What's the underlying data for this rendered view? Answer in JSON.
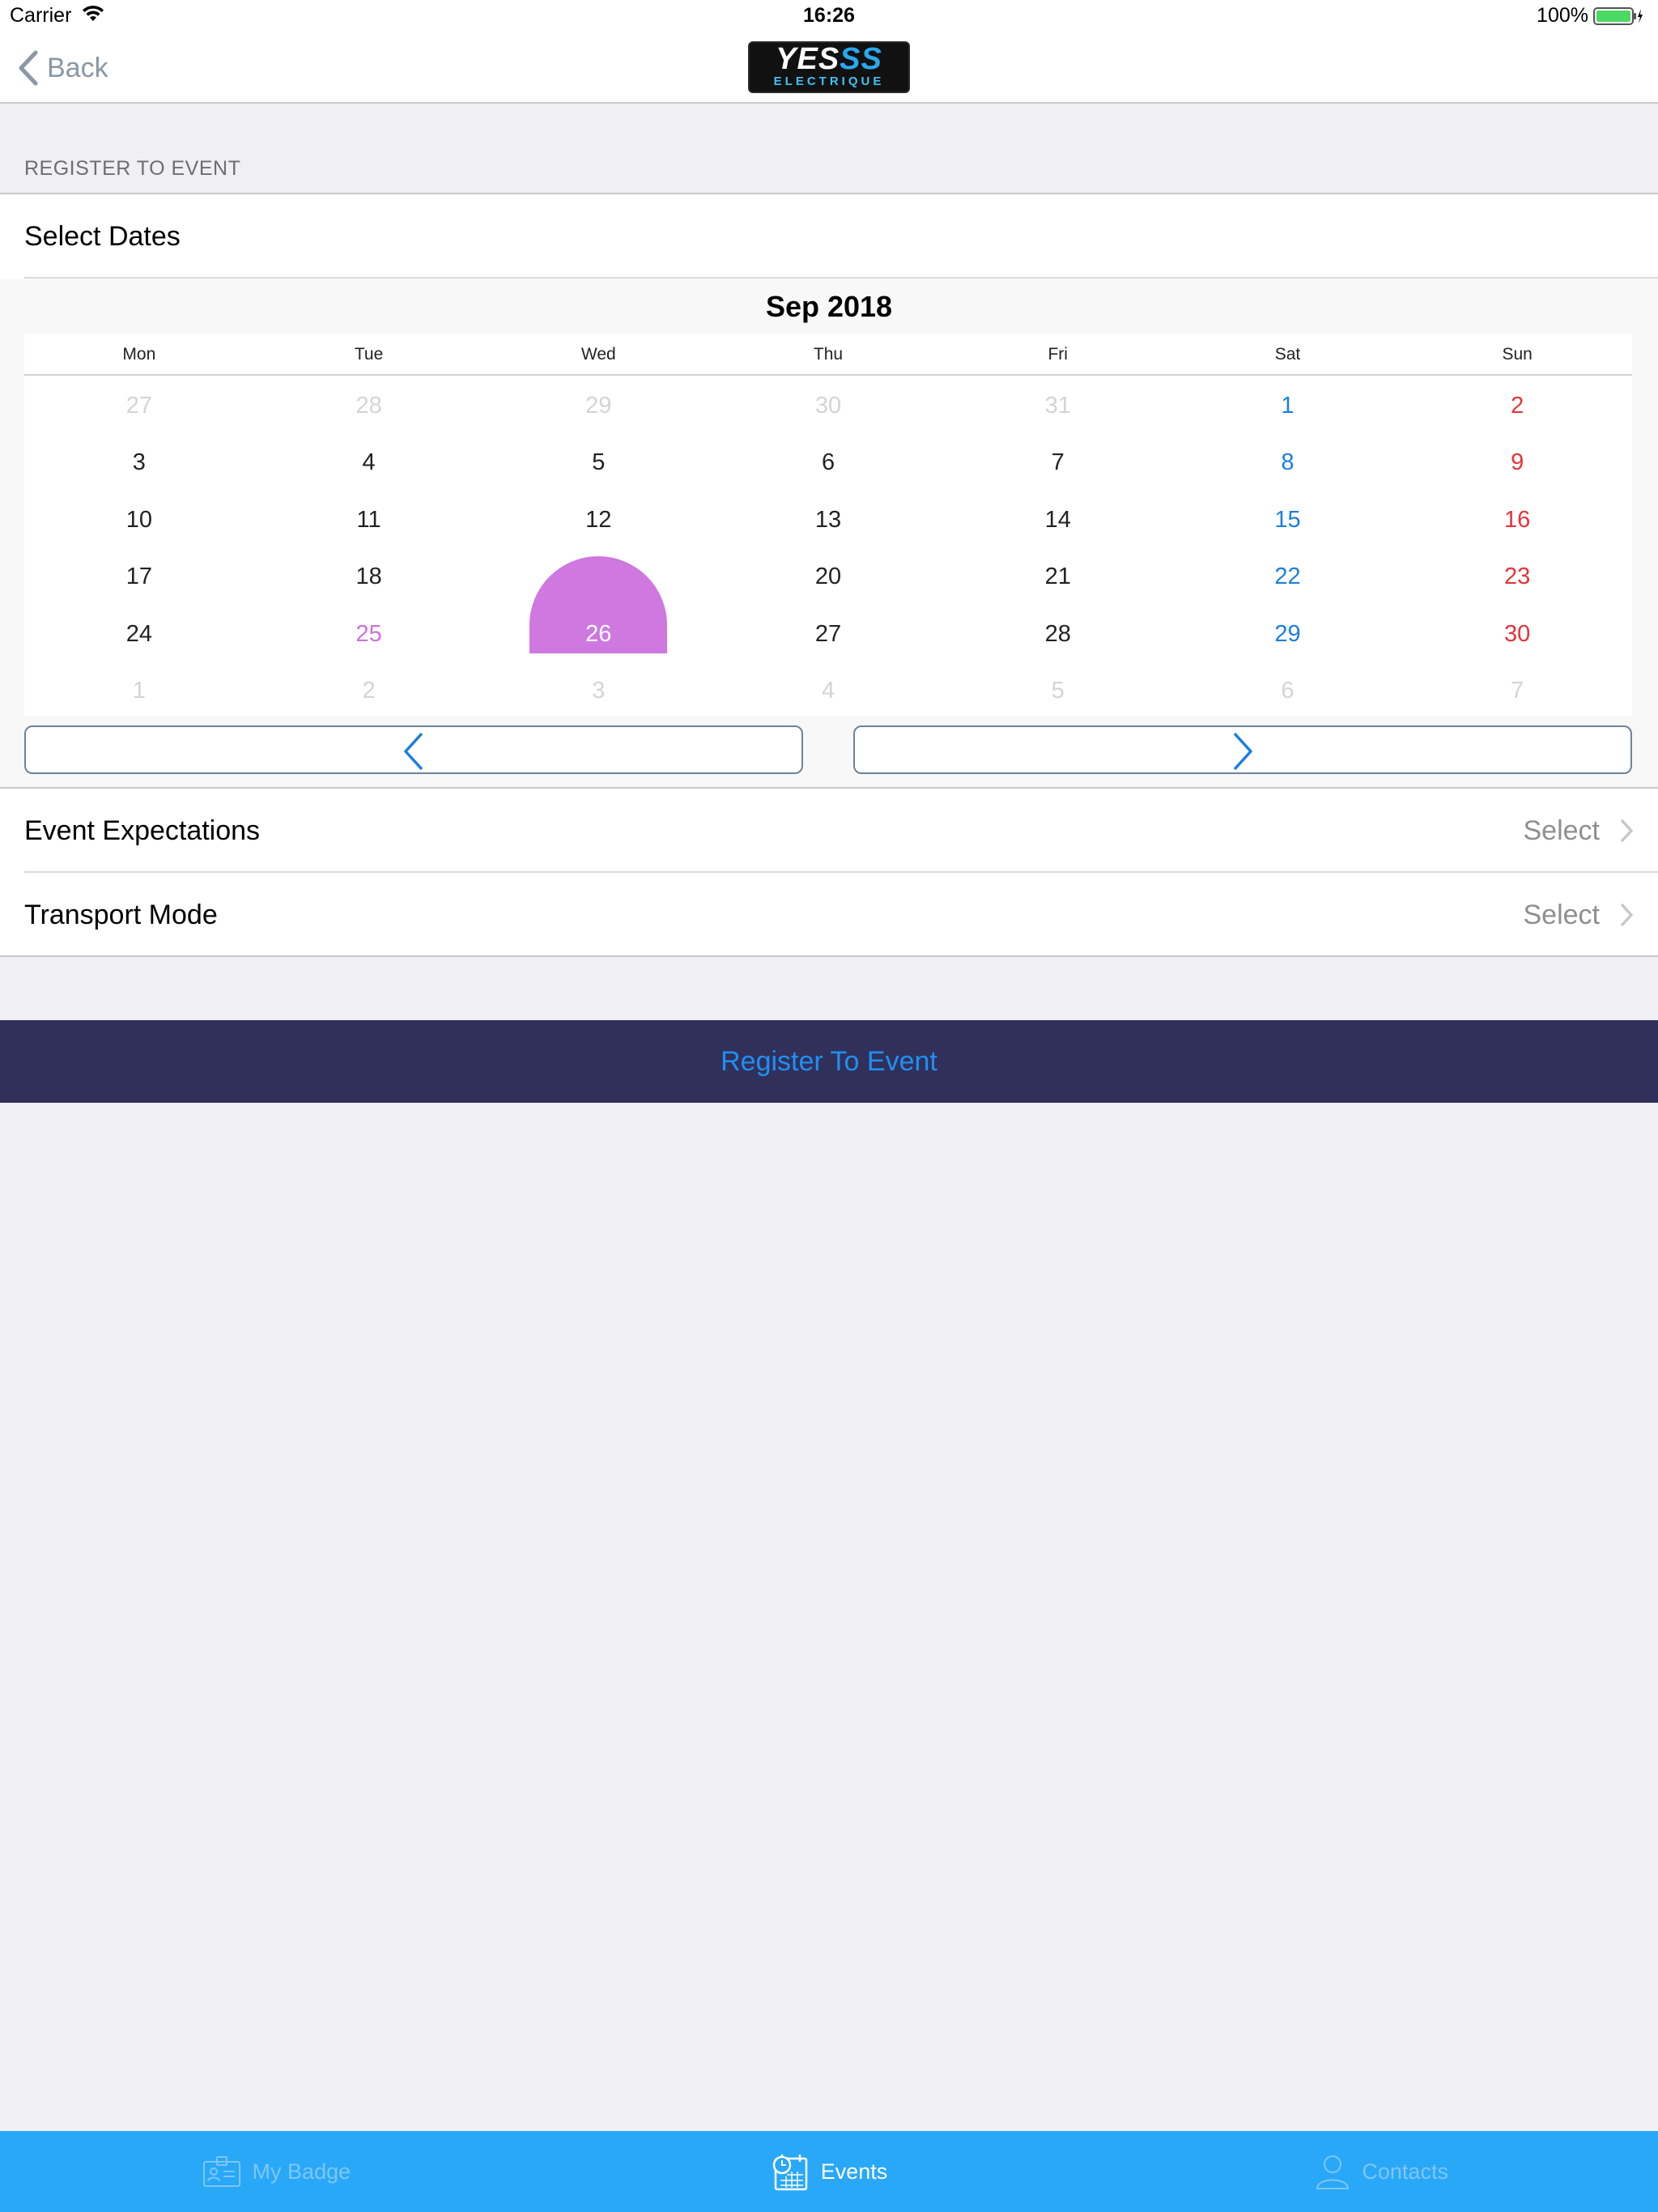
{
  "status_bar": {
    "carrier": "Carrier",
    "time": "16:26",
    "battery": "100%"
  },
  "nav": {
    "back_label": "Back",
    "logo_top_white": "YES",
    "logo_top_blue": "SS",
    "logo_bottom": "ELECTRIQUE"
  },
  "section_header": "REGISTER TO EVENT",
  "select_dates_label": "Select Dates",
  "calendar": {
    "month_title": "Sep 2018",
    "weekdays": [
      "Mon",
      "Tue",
      "Wed",
      "Thu",
      "Fri",
      "Sat",
      "Sun"
    ],
    "weeks": [
      [
        {
          "d": "27",
          "t": "muted"
        },
        {
          "d": "28",
          "t": "muted"
        },
        {
          "d": "29",
          "t": "muted"
        },
        {
          "d": "30",
          "t": "muted"
        },
        {
          "d": "31",
          "t": "muted"
        },
        {
          "d": "1",
          "t": "sat"
        },
        {
          "d": "2",
          "t": "sun"
        }
      ],
      [
        {
          "d": "3",
          "t": "normal"
        },
        {
          "d": "4",
          "t": "normal"
        },
        {
          "d": "5",
          "t": "normal"
        },
        {
          "d": "6",
          "t": "normal"
        },
        {
          "d": "7",
          "t": "normal"
        },
        {
          "d": "8",
          "t": "sat"
        },
        {
          "d": "9",
          "t": "sun"
        }
      ],
      [
        {
          "d": "10",
          "t": "normal"
        },
        {
          "d": "11",
          "t": "normal"
        },
        {
          "d": "12",
          "t": "normal"
        },
        {
          "d": "13",
          "t": "normal"
        },
        {
          "d": "14",
          "t": "normal"
        },
        {
          "d": "15",
          "t": "sat"
        },
        {
          "d": "16",
          "t": "sun"
        }
      ],
      [
        {
          "d": "17",
          "t": "normal"
        },
        {
          "d": "18",
          "t": "normal"
        },
        {
          "d": "",
          "t": "bubble-top"
        },
        {
          "d": "20",
          "t": "normal"
        },
        {
          "d": "21",
          "t": "normal"
        },
        {
          "d": "22",
          "t": "sat"
        },
        {
          "d": "23",
          "t": "sun"
        }
      ],
      [
        {
          "d": "24",
          "t": "normal"
        },
        {
          "d": "25",
          "t": "today"
        },
        {
          "d": "26",
          "t": "selected"
        },
        {
          "d": "27",
          "t": "normal"
        },
        {
          "d": "28",
          "t": "normal"
        },
        {
          "d": "29",
          "t": "sat"
        },
        {
          "d": "30",
          "t": "sun"
        }
      ],
      [
        {
          "d": "1",
          "t": "muted"
        },
        {
          "d": "2",
          "t": "muted"
        },
        {
          "d": "3",
          "t": "muted"
        },
        {
          "d": "4",
          "t": "muted"
        },
        {
          "d": "5",
          "t": "muted"
        },
        {
          "d": "6",
          "t": "muted"
        },
        {
          "d": "7",
          "t": "muted"
        }
      ]
    ],
    "selected_date": "26",
    "today_date": "25"
  },
  "rows": {
    "event_expectations": {
      "label": "Event Expectations",
      "value": "Select"
    },
    "transport_mode": {
      "label": "Transport Mode",
      "value": "Select"
    }
  },
  "register_button": "Register To Event",
  "tabs": [
    {
      "label": "My Badge",
      "icon": "badge-icon",
      "active": false
    },
    {
      "label": "Events",
      "icon": "calendar-clock-icon",
      "active": true
    },
    {
      "label": "Contacts",
      "icon": "person-icon",
      "active": false
    }
  ],
  "colors": {
    "tab_bar": "#29A8F8",
    "register_bg": "#31305B",
    "register_text": "#1E90F2",
    "selected_day": "#CE78E0",
    "saturday": "#1A7FE0",
    "sunday": "#E8333A"
  }
}
